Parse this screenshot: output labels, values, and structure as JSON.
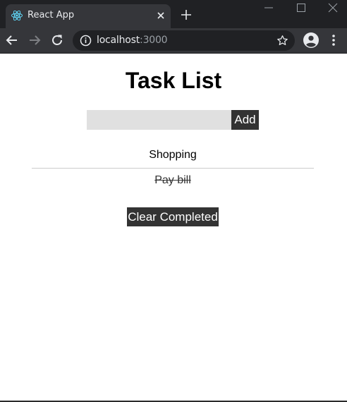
{
  "browser": {
    "tab_title": "React App",
    "url_host": "localhost",
    "url_port": ":3000",
    "colors": {
      "tabstrip": "#202124",
      "toolbar": "#35363a",
      "omnibox": "#202124",
      "react_logo": "#61dafb"
    }
  },
  "page": {
    "title": "Task List",
    "input": {
      "value": "",
      "placeholder": ""
    },
    "add_label": "Add",
    "tasks": [
      {
        "text": "Shopping",
        "completed": false
      },
      {
        "text": "Pay bill",
        "completed": true
      }
    ],
    "clear_label": "Clear Completed",
    "colors": {
      "button_bg": "#333333",
      "input_bg": "#e0e0e0"
    }
  }
}
